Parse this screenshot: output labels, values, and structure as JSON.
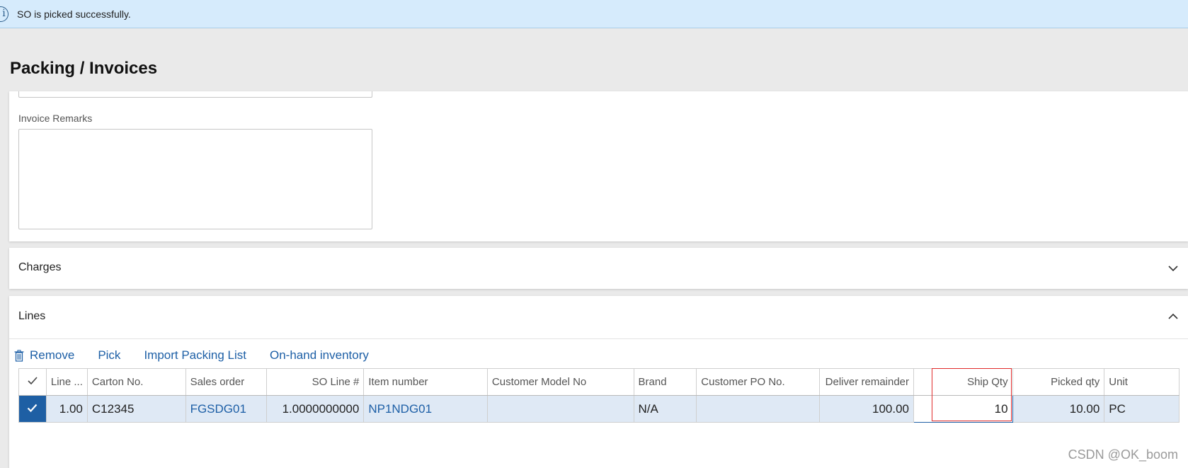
{
  "message": {
    "text": "SO is picked successfully.",
    "icon": "info-icon"
  },
  "page": {
    "title": "Packing / Invoices"
  },
  "invoice": {
    "remarks_label": "Invoice Remarks",
    "remarks_value": ""
  },
  "charges": {
    "title": "Charges",
    "expanded": false
  },
  "lines": {
    "title": "Lines",
    "expanded": true,
    "toolbar": {
      "remove": "Remove",
      "pick": "Pick",
      "import": "Import Packing List",
      "onhand": "On-hand inventory"
    },
    "columns": {
      "line": "Line ...",
      "carton": "Carton No.",
      "sales_order": "Sales order",
      "so_line": "SO Line #",
      "item": "Item number",
      "model": "Customer Model No",
      "brand": "Brand",
      "po": "Customer PO No.",
      "remainder": "Deliver remainder",
      "ship_qty": "Ship Qty",
      "picked": "Picked qty",
      "unit": "Unit"
    },
    "rows": [
      {
        "selected": true,
        "line": "1.00",
        "carton": "C12345",
        "sales_order": "FGSDG01",
        "so_line": "1.0000000000",
        "item": "NP1NDG01",
        "model": "",
        "brand": "N/A",
        "po": "",
        "remainder": "100.00",
        "ship_qty": "10",
        "picked": "10.00",
        "unit": "PC"
      }
    ]
  },
  "watermark": "CSDN @OK_boom",
  "colors": {
    "accent": "#1e5fa4",
    "link": "#1d5fa6",
    "info_bg": "#d6ebfc",
    "highlight": "#e02b2b"
  }
}
